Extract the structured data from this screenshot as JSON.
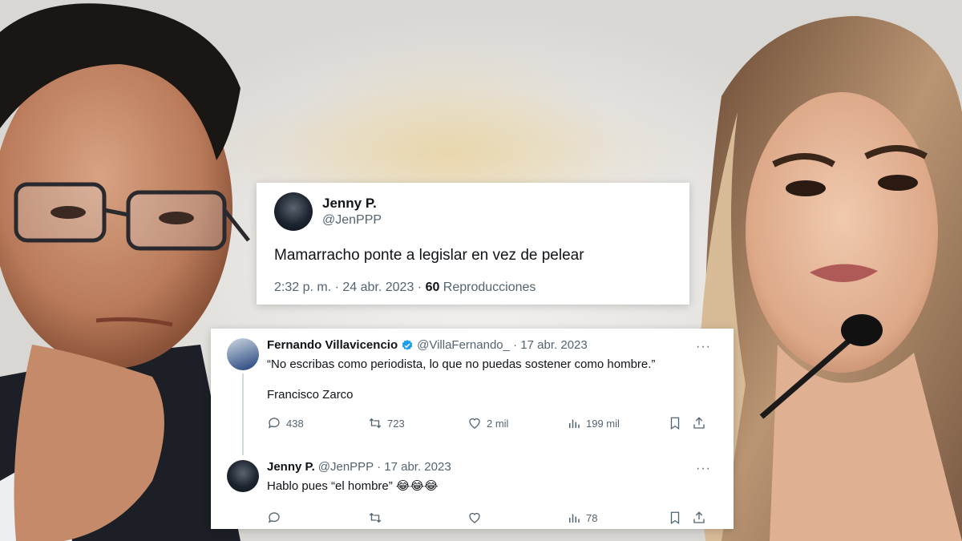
{
  "tweet_top": {
    "name": "Jenny P.",
    "handle": "@JenPPP",
    "text": "Mamarracho ponte a legislar en vez de pelear",
    "time": "2:32 p. m. · 24 abr. 2023 · ",
    "views_count": "60",
    "views_label": " Reproducciones"
  },
  "tweet_fv": {
    "name": "Fernando Villavicencio",
    "handle": "@VillaFernando_ · 17 abr. 2023",
    "text": "“No escribas como periodista, lo que no puedas sostener como hombre.”",
    "text2": "Francisco Zarco",
    "replies": "438",
    "retweets": "723",
    "likes": "2 mil",
    "views": "199 mil",
    "more": "···"
  },
  "tweet_reply": {
    "name": "Jenny P.",
    "handle": "@JenPPP · 17 abr. 2023",
    "text": "Hablo pues “el hombre” 😂😂😂",
    "views": "78",
    "more": "···"
  },
  "colors": {
    "accent": "#1d9bf0",
    "muted": "#536471",
    "text": "#0f1419"
  }
}
